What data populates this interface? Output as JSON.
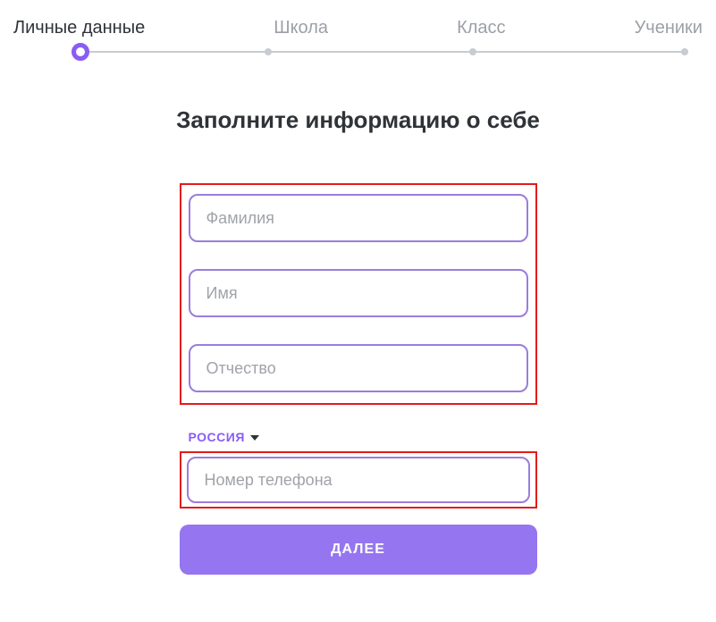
{
  "stepper": {
    "steps": [
      {
        "label": "Личные данные",
        "active": true
      },
      {
        "label": "Школа",
        "active": false
      },
      {
        "label": "Класс",
        "active": false
      },
      {
        "label": "Ученики",
        "active": false
      }
    ]
  },
  "title": "Заполните информацию о себе",
  "form": {
    "lastname_placeholder": "Фамилия",
    "firstname_placeholder": "Имя",
    "middlename_placeholder": "Отчество",
    "country_label": "РОССИЯ",
    "phone_placeholder": "Номер телефона",
    "submit_label": "ДАЛЕЕ"
  }
}
